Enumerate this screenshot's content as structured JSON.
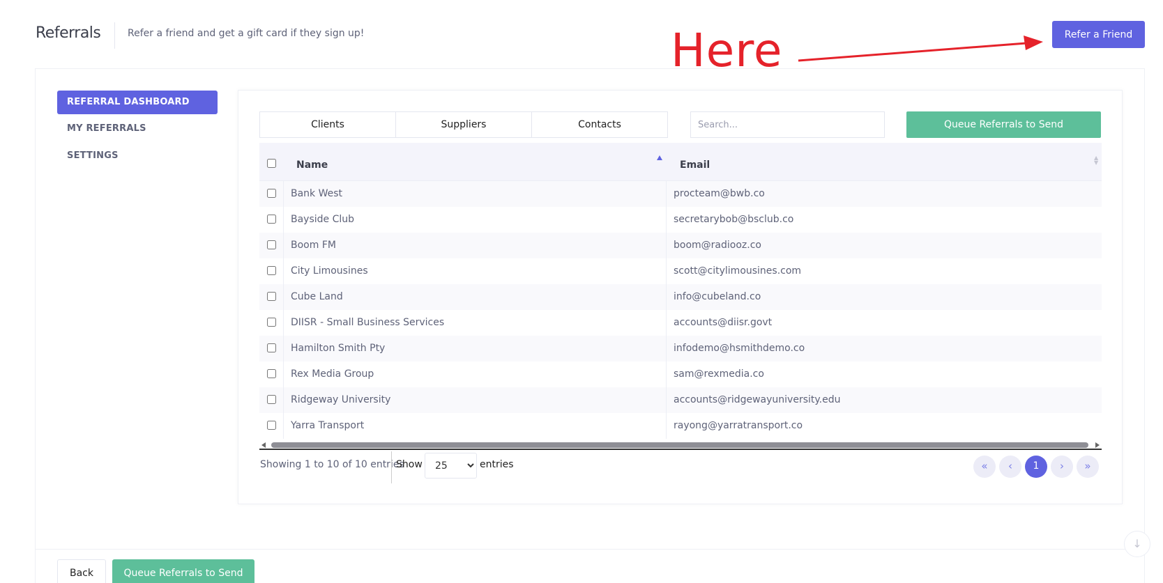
{
  "header": {
    "title": "Referrals",
    "subtitle": "Refer a friend and get a gift card if they sign up!",
    "refer_button": "Refer a Friend"
  },
  "annotation": {
    "text": "Here",
    "color": "#e5222a"
  },
  "sidebar": {
    "items": [
      {
        "label": "REFERRAL DASHBOARD",
        "active": true
      },
      {
        "label": "MY REFERRALS",
        "active": false
      },
      {
        "label": "SETTINGS",
        "active": false
      }
    ]
  },
  "tabs": [
    "Clients",
    "Suppliers",
    "Contacts"
  ],
  "search": {
    "placeholder": "Search..."
  },
  "queue_button": "Queue Referrals to Send",
  "table": {
    "columns": [
      "Name",
      "Email"
    ],
    "rows": [
      {
        "name": "Bank West",
        "email": "procteam@bwb.co"
      },
      {
        "name": "Bayside Club",
        "email": "secretarybob@bsclub.co"
      },
      {
        "name": "Boom FM",
        "email": "boom@radiooz.co"
      },
      {
        "name": "City Limousines",
        "email": "scott@citylimousines.com"
      },
      {
        "name": "Cube Land",
        "email": "info@cubeland.co"
      },
      {
        "name": "DIISR - Small Business Services",
        "email": "accounts@diisr.govt"
      },
      {
        "name": "Hamilton Smith Pty",
        "email": "infodemo@hsmithdemo.co"
      },
      {
        "name": "Rex Media Group",
        "email": "sam@rexmedia.co"
      },
      {
        "name": "Ridgeway University",
        "email": "accounts@ridgewayuniversity.edu"
      },
      {
        "name": "Yarra Transport",
        "email": "rayong@yarratransport.co"
      }
    ]
  },
  "footer": {
    "showing": "Showing 1 to 10 of 10 entries",
    "show_label": "Show",
    "entries_value": "25",
    "entries_label": "entries",
    "pagination": {
      "first": "«",
      "prev": "‹",
      "current": "1",
      "next": "›",
      "last": "»"
    }
  },
  "bottom": {
    "back": "Back",
    "queue": "Queue Referrals to Send"
  },
  "colors": {
    "accent": "#5f62e0",
    "success": "#5dbf9a"
  }
}
